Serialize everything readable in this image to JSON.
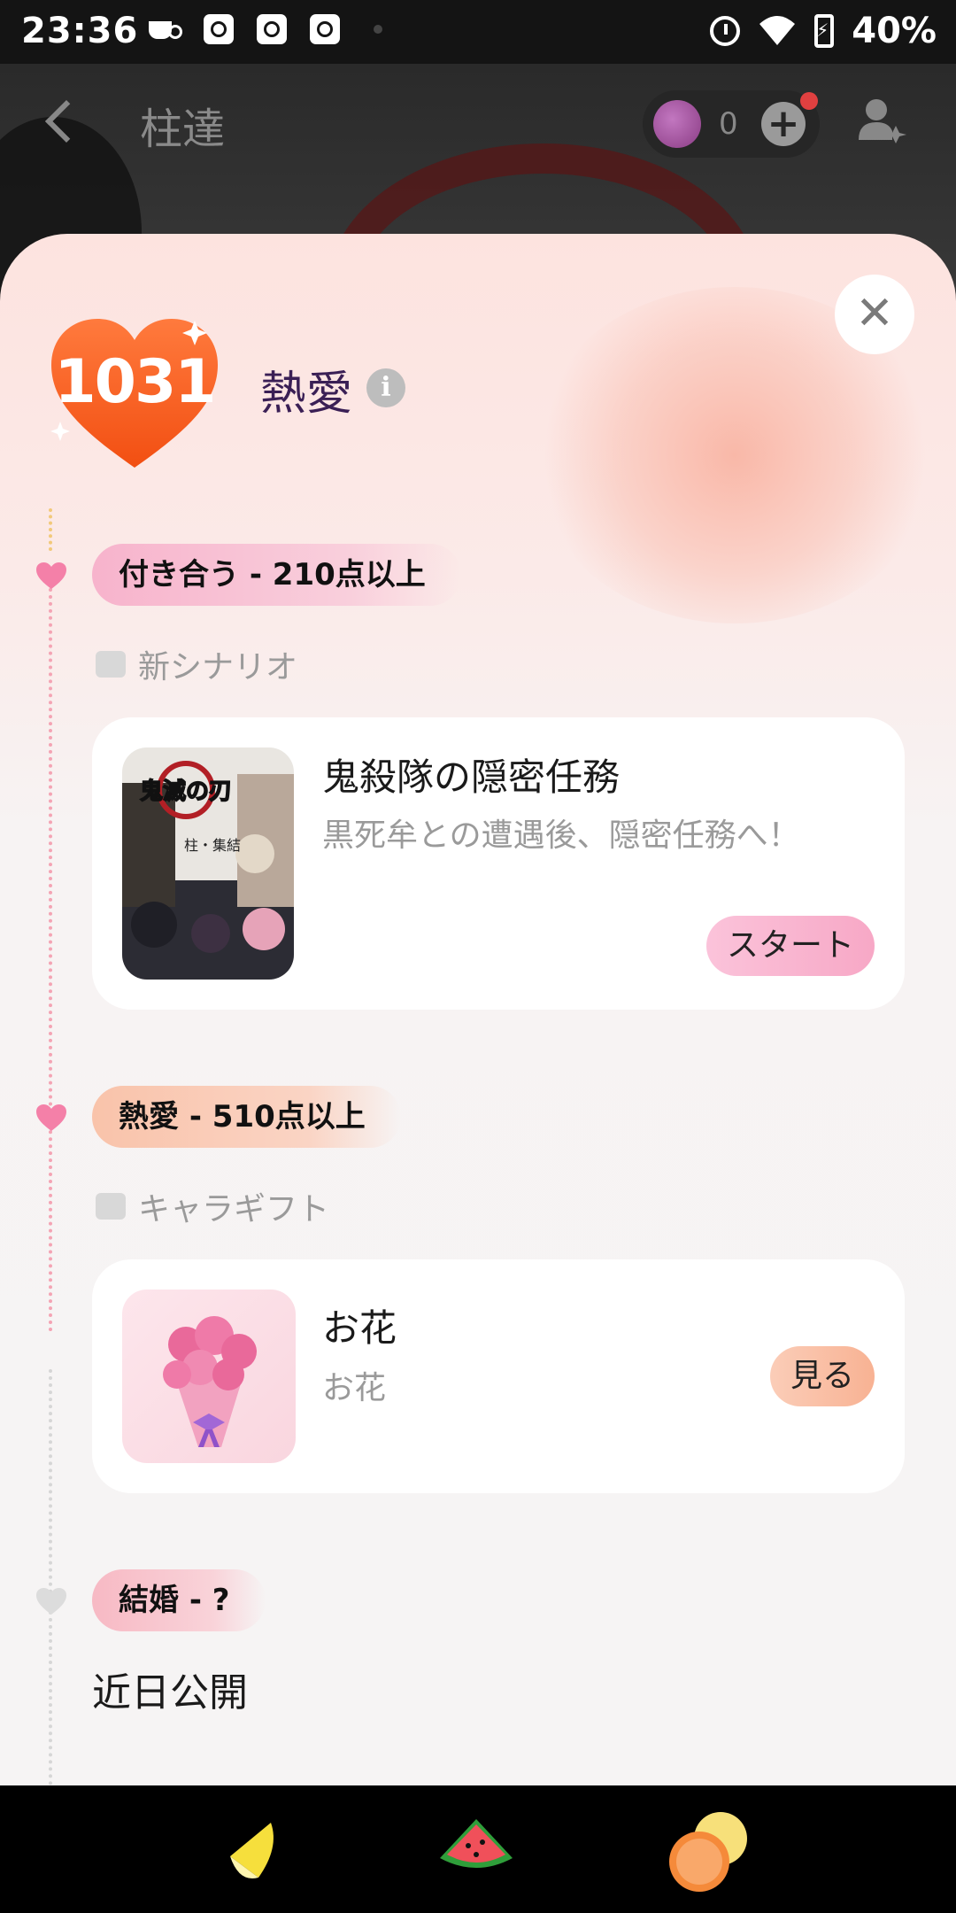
{
  "status_bar": {
    "time": "23:36",
    "battery": "40%"
  },
  "header": {
    "title": "柱達",
    "coin_count": "0"
  },
  "affection": {
    "score": "1031",
    "level": "熱愛"
  },
  "stages": [
    {
      "tag": "付き合う - 210点以上",
      "section": "新シナリオ",
      "card": {
        "title": "鬼殺隊の隠密任務",
        "description": "黒死牟との遭遇後、隠密任務へ！",
        "button": "スタート",
        "thumb_title": "鬼滅の刃",
        "thumb_sub": "柱・集結"
      }
    },
    {
      "tag": "熱愛 - 510点以上",
      "section": "キャラギフト",
      "card": {
        "title": "お花",
        "description": "お花",
        "button": "見る"
      }
    },
    {
      "tag": "結婚 - ?",
      "note": "近日公開"
    }
  ],
  "bottom_nav": [
    "lemon-icon",
    "watermelon-icon",
    "orange-icon"
  ],
  "colors": {
    "heart": "#f76b1c",
    "tag_pink": "#f7b3cc",
    "tag_peach": "#f9c3aa",
    "button_pink": "#f9b4d0",
    "button_peach": "#f9bea3"
  }
}
